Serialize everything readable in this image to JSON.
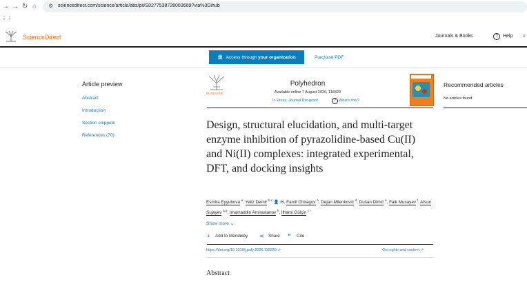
{
  "browser": {
    "url": "sciencedirect.com/science/article/abs/pii/S0277538726003669?via%3Dihub"
  },
  "header": {
    "brand": "ScienceDirect",
    "journals_books": "Journals & Books",
    "help": "Help"
  },
  "access": {
    "access_prefix": "Access through ",
    "access_bold": "your organization",
    "purchase": "Purchase PDF"
  },
  "preview": {
    "title": "Article preview",
    "links": [
      "Abstract",
      "Introduction",
      "Section snippets",
      "References (70)"
    ]
  },
  "journal": {
    "publisher_logo_text": "ELSEVIER",
    "name": "Polyhedron",
    "available": "Available online 7 August 2026, 118320",
    "status": "In Press, Journal Pre-proof",
    "whats_this": "What's this?"
  },
  "article": {
    "title": "Design, structural elucidation, and multi-target enzyme inhibition of pyrazolidine-based Cu(II) and Ni(II) complexes: integrated experimental, DFT, and docking insights",
    "authors": [
      {
        "name": "Esmira Eyyubova",
        "aff": "a"
      },
      {
        "name": "Yeliz Demir",
        "aff": "b c"
      },
      {
        "name": "Famil Chiragov",
        "aff": "a"
      },
      {
        "name": "Dejan Milenković",
        "aff": "d"
      },
      {
        "name": "Dušan Dimić",
        "aff": "e"
      },
      {
        "name": "Faik Musayev",
        "aff": "f"
      },
      {
        "name": "Afsun Sujayev",
        "aff": "a g"
      },
      {
        "name": "Imamaddin Amiraslanov",
        "aff": "h"
      },
      {
        "name": "İlhami Gülçin",
        "aff": "c i"
      }
    ],
    "show_more": "Show more",
    "add_mendeley": "Add to Mendeley",
    "share": "Share",
    "cite": "Cite",
    "doi": "https://doi.org/10.1016/j.poly.2026.118320",
    "rights": "Get rights and content",
    "abstract_heading": "Abstract"
  },
  "recommended": {
    "title": "Recommended articles",
    "none": "No articles found."
  },
  "colors": {
    "link": "#0c7dbb",
    "brand": "#e9711c",
    "access_button": "#0c7dbb"
  }
}
